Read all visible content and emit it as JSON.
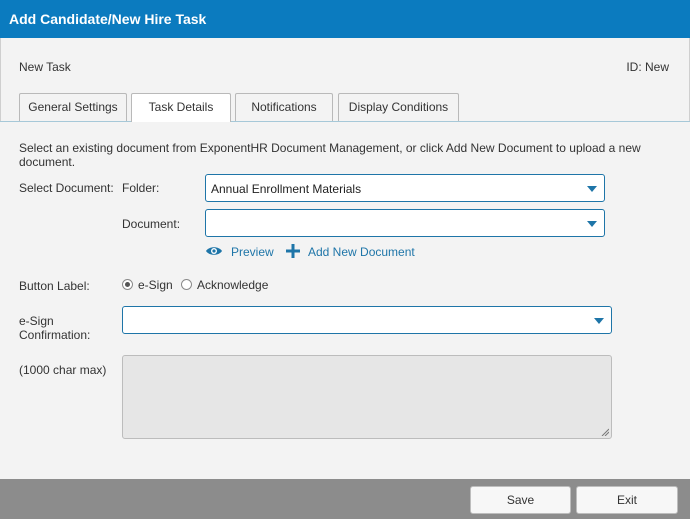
{
  "dialog": {
    "title": "Add Candidate/New Hire Task",
    "subtitle": "New Task",
    "id_label": "ID: New"
  },
  "tabs": [
    {
      "label": "General Settings"
    },
    {
      "label": "Task Details",
      "active": true
    },
    {
      "label": "Notifications"
    },
    {
      "label": "Display Conditions"
    }
  ],
  "form": {
    "instructions": "Select an existing document from ExponentHR Document Management, or click Add New Document to upload a new document.",
    "select_document_label": "Select Document:",
    "folder_label": "Folder:",
    "folder_value": "Annual Enrollment Materials",
    "document_label": "Document:",
    "document_value": "",
    "preview_link": "Preview",
    "add_new_document_link": "Add New Document",
    "button_label_label": "Button Label:",
    "button_label_options": [
      {
        "label": "e-Sign",
        "selected": true
      },
      {
        "label": "Acknowledge",
        "selected": false
      }
    ],
    "esign_confirmation_label": "e-Sign Confirmation:",
    "esign_confirmation_value": "",
    "char_max_label": "(1000 char max)",
    "textarea_value": ""
  },
  "footer": {
    "save_label": "Save",
    "exit_label": "Exit"
  },
  "colors": {
    "title_bar": "#0b7bbf",
    "accent": "#1e75a8",
    "footer_bar": "#8c8c8c"
  }
}
